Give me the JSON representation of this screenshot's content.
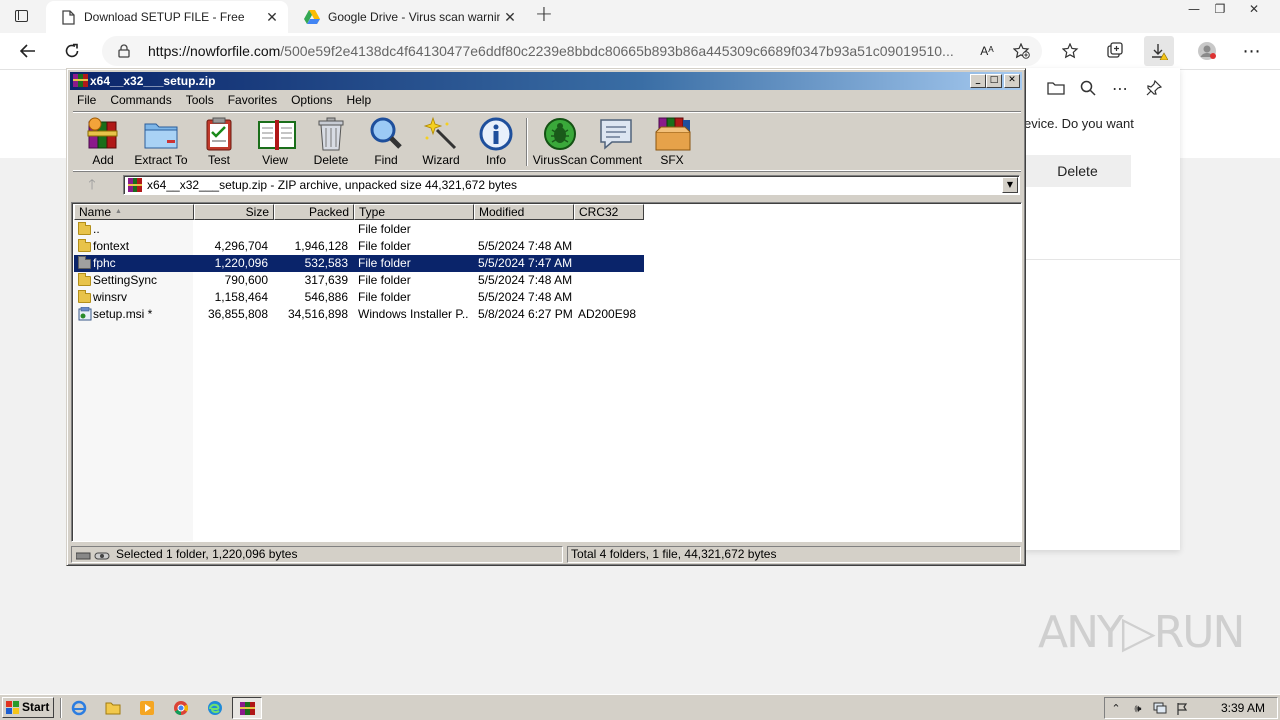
{
  "browser": {
    "tabs": [
      {
        "title": "Download SETUP FILE - Free",
        "active": true,
        "close": "✕"
      },
      {
        "title": "Google Drive - Virus scan warning",
        "active": false,
        "close": "✕"
      }
    ],
    "new_tab": "+",
    "window_controls": [
      "—",
      "❐",
      "✕"
    ],
    "url_domain": "https://nowforfile.com",
    "url_path": "/500e59f2e4138dc4f64130477e6ddf80c2239e8bbdc80665b893b86a445309c6689f0347b93a51c09019510...",
    "read_aloud_label": "Aᴬ",
    "accent_color": "#0a246a"
  },
  "download_panel": {
    "partial_text": "evice. Do you want",
    "delete_label": "Delete"
  },
  "watermark": "ANY▷RUN",
  "winrar": {
    "title": "x64__x32___setup.zip",
    "menu": [
      "File",
      "Commands",
      "Tools",
      "Favorites",
      "Options",
      "Help"
    ],
    "tools": [
      {
        "label": "Add",
        "icon": "add-books-icon"
      },
      {
        "label": "Extract To",
        "icon": "extract-folder-icon"
      },
      {
        "label": "Test",
        "icon": "test-clipboard-icon"
      },
      {
        "label": "View",
        "icon": "view-book-icon"
      },
      {
        "label": "Delete",
        "icon": "trash-can-icon"
      },
      {
        "label": "Find",
        "icon": "magnifier-icon"
      },
      {
        "label": "Wizard",
        "icon": "magic-wand-icon"
      },
      {
        "label": "Info",
        "icon": "info-icon"
      },
      {
        "label": "VirusScan",
        "icon": "virus-bug-icon"
      },
      {
        "label": "Comment",
        "icon": "comment-icon"
      },
      {
        "label": "SFX",
        "icon": "sfx-box-icon"
      }
    ],
    "path": "x64__x32___setup.zip - ZIP archive, unpacked size 44,321,672 bytes",
    "columns": [
      "Name",
      "Size",
      "Packed",
      "Type",
      "Modified",
      "CRC32"
    ],
    "sort_indicator": "▲",
    "rows": [
      {
        "name": "..",
        "size": "",
        "packed": "",
        "type": "File folder",
        "modified": "",
        "crc": "",
        "selected": false
      },
      {
        "name": "fontext",
        "size": "4,296,704",
        "packed": "1,946,128",
        "type": "File folder",
        "modified": "5/5/2024 7:48 AM",
        "crc": "",
        "selected": false
      },
      {
        "name": "fphc",
        "size": "1,220,096",
        "packed": "532,583",
        "type": "File folder",
        "modified": "5/5/2024 7:47 AM",
        "crc": "",
        "selected": true
      },
      {
        "name": "SettingSync",
        "size": "790,600",
        "packed": "317,639",
        "type": "File folder",
        "modified": "5/5/2024 7:48 AM",
        "crc": "",
        "selected": false
      },
      {
        "name": "winsrv",
        "size": "1,158,464",
        "packed": "546,886",
        "type": "File folder",
        "modified": "5/5/2024 7:48 AM",
        "crc": "",
        "selected": false
      },
      {
        "name": "setup.msi *",
        "size": "36,855,808",
        "packed": "34,516,898",
        "type": "Windows Installer P...",
        "modified": "5/8/2024 6:27 PM",
        "crc": "AD200E98",
        "selected": false
      }
    ],
    "status_left": "Selected 1 folder, 1,220,096 bytes",
    "status_right": "Total 4 folders, 1 file, 44,321,672 bytes"
  },
  "taskbar": {
    "start_label": "Start",
    "clock": "3:39 AM"
  }
}
